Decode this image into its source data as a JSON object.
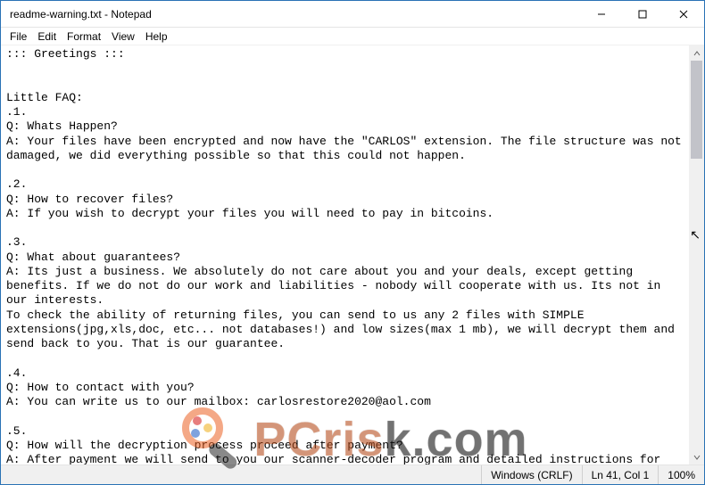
{
  "titlebar": {
    "title": "readme-warning.txt - Notepad"
  },
  "menu": {
    "file": "File",
    "edit": "Edit",
    "format": "Format",
    "view": "View",
    "help": "Help"
  },
  "doc": {
    "text": "::: Greetings :::\n\n\nLittle FAQ:\n.1.\nQ: Whats Happen?\nA: Your files have been encrypted and now have the \"CARLOS\" extension. The file structure was not damaged, we did everything possible so that this could not happen.\n\n.2.\nQ: How to recover files?\nA: If you wish to decrypt your files you will need to pay in bitcoins.\n\n.3.\nQ: What about guarantees?\nA: Its just a business. We absolutely do not care about you and your deals, except getting benefits. If we do not do our work and liabilities - nobody will cooperate with us. Its not in our interests.\nTo check the ability of returning files, you can send to us any 2 files with SIMPLE extensions(jpg,xls,doc, etc... not databases!) and low sizes(max 1 mb), we will decrypt them and send back to you. That is our guarantee.\n\n.4.\nQ: How to contact with you?\nA: You can write us to our mailbox: carlosrestore2020@aol.com\n\n.5.\nQ: How will the decryption process proceed after payment?\nA: After payment we will send to you our scanner-decoder program and detailed instructions for use. With this program you will be able to decrypt all your encrypted files."
  },
  "status": {
    "encoding": "Windows (CRLF)",
    "position": "Ln 41, Col 1",
    "zoom": "100%"
  },
  "watermark": {
    "brand_left": "PCris",
    "brand_mid": "k",
    "brand_right": ".com"
  }
}
